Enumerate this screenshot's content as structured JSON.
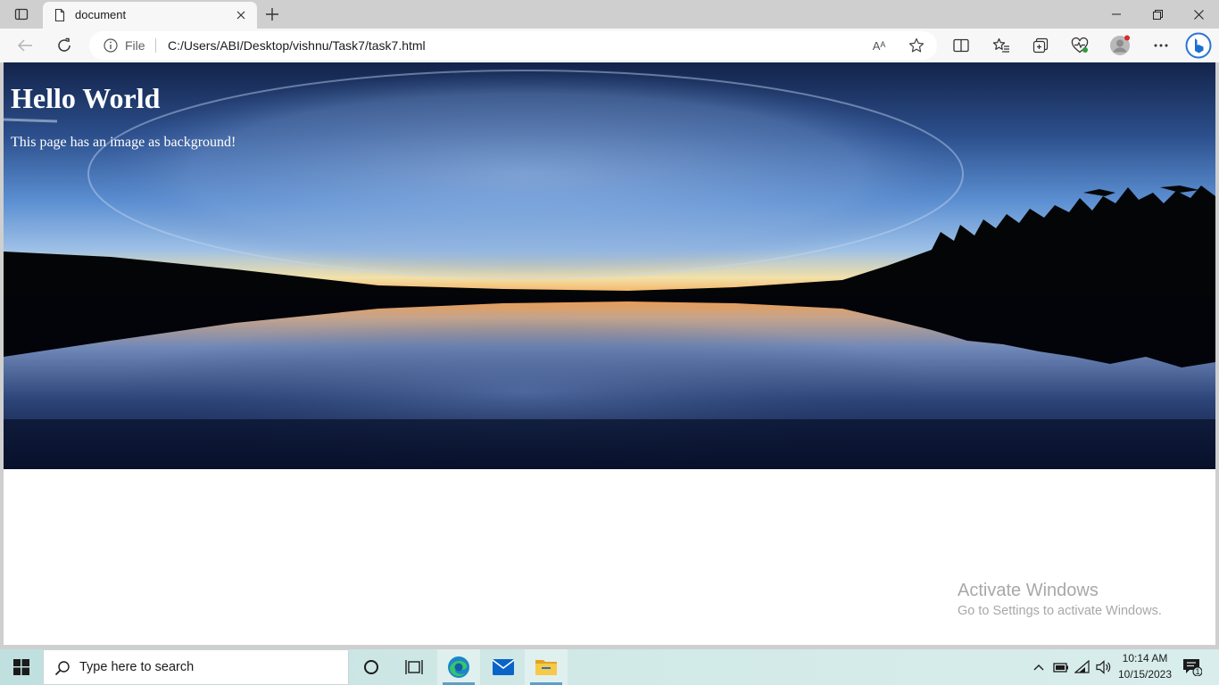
{
  "browser": {
    "tab": {
      "title": "document"
    },
    "address_bar": {
      "site_info_label": "File",
      "url": "C:/Users/ABI/Desktop/vishnu/Task7/task7.html"
    },
    "read_aloud_label": "Aᴬ"
  },
  "page": {
    "heading": "Hello World",
    "paragraph": "This page has an image as background!"
  },
  "watermark": {
    "title": "Activate Windows",
    "subtitle": "Go to Settings to activate Windows."
  },
  "taskbar": {
    "search_placeholder": "Type here to search",
    "clock_time": "10:14 AM",
    "clock_date": "10/15/2023",
    "notification_count": "1"
  },
  "colors": {
    "titlebar": "#cfcfcf",
    "toolbar": "#f7f7f7",
    "accent": "#0078d4",
    "taskbar": "#cfe8e6"
  },
  "icons": [
    "tab-actions-icon",
    "page-icon",
    "close-icon",
    "plus-icon",
    "minimize-icon",
    "restore-icon",
    "back-arrow-icon",
    "refresh-icon",
    "info-icon",
    "read-aloud-icon",
    "star-icon",
    "split-screen-icon",
    "favorites-icon",
    "collections-icon",
    "browser-essentials-icon",
    "profile-avatar-icon",
    "more-icon",
    "bing-icon",
    "windows-logo-icon",
    "search-icon",
    "cortana-icon",
    "task-view-icon",
    "edge-icon",
    "mail-icon",
    "file-explorer-icon",
    "chevron-up-icon",
    "battery-icon",
    "wifi-icon",
    "volume-icon",
    "notification-icon"
  ]
}
